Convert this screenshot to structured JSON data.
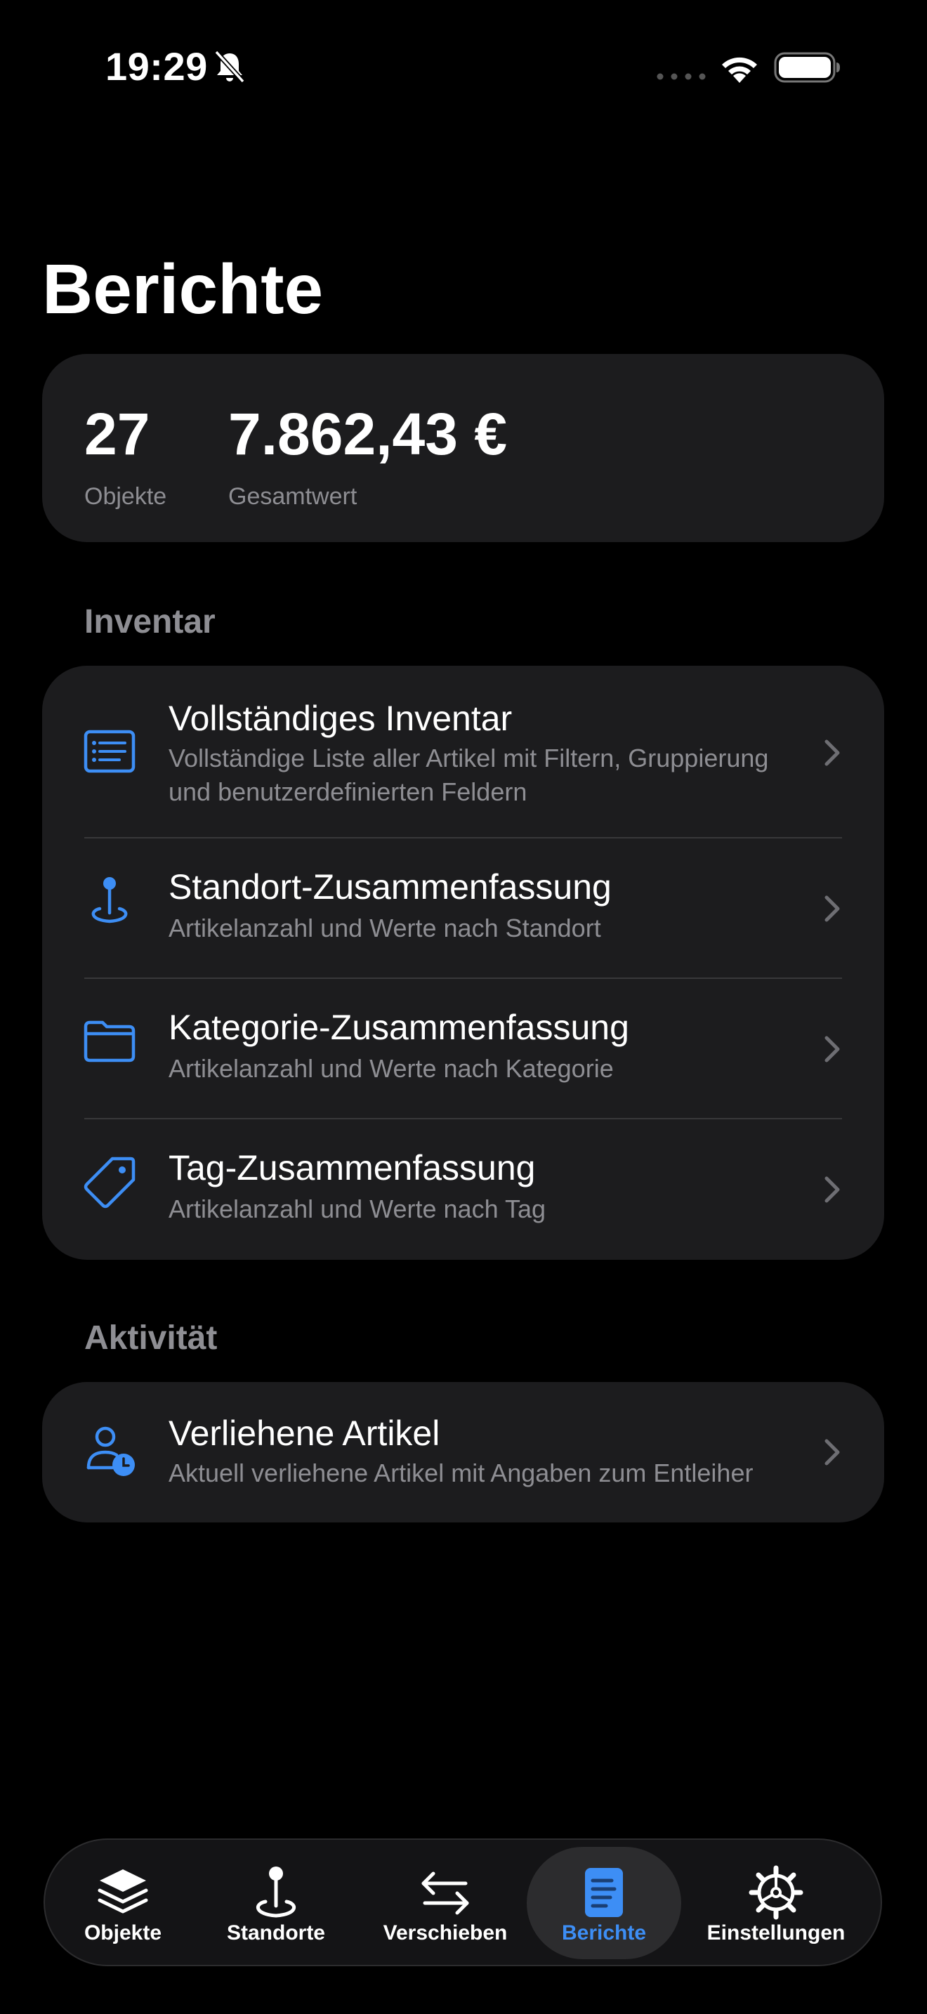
{
  "status_bar": {
    "time": "19:29",
    "icons": [
      "bell-slash-icon",
      "cellular-dots-icon",
      "wifi-icon",
      "battery-icon"
    ]
  },
  "page": {
    "title": "Berichte"
  },
  "summary": {
    "objects_value": "27",
    "objects_label": "Objekte",
    "total_value": "7.862,43 €",
    "total_label": "Gesamtwert"
  },
  "sections": {
    "inventory": {
      "header": "Inventar",
      "items": [
        {
          "icon": "list-icon",
          "title": "Vollständiges Inventar",
          "subtitle": "Vollständige Liste aller Artikel mit Filtern, Gruppierung und benutzerdefinierten Feldern"
        },
        {
          "icon": "location-pin-icon",
          "title": "Standort-Zusammenfassung",
          "subtitle": "Artikelanzahl und Werte nach Standort"
        },
        {
          "icon": "folder-icon",
          "title": "Kategorie-Zusammenfassung",
          "subtitle": "Artikelanzahl und Werte nach Kategorie"
        },
        {
          "icon": "tag-icon",
          "title": "Tag-Zusammenfassung",
          "subtitle": "Artikelanzahl und Werte nach Tag"
        }
      ]
    },
    "activity": {
      "header": "Aktivität",
      "items": [
        {
          "icon": "person-clock-icon",
          "title": "Verliehene Artikel",
          "subtitle": "Aktuell verliehene Artikel mit Angaben zum Entleiher"
        }
      ]
    }
  },
  "tab_bar": {
    "tabs": [
      {
        "label": "Objekte",
        "icon": "stack-icon",
        "active": false
      },
      {
        "label": "Standorte",
        "icon": "location-pin-icon",
        "active": false
      },
      {
        "label": "Verschieben",
        "icon": "arrows-left-right-icon",
        "active": false
      },
      {
        "label": "Berichte",
        "icon": "document-icon",
        "active": true
      },
      {
        "label": "Einstellungen",
        "icon": "gear-icon",
        "active": false
      }
    ]
  },
  "colors": {
    "background": "#000000",
    "card": "#1c1c1e",
    "accent": "#3d8ef5",
    "secondary_text": "#8e8e93",
    "divider": "#38383a"
  }
}
